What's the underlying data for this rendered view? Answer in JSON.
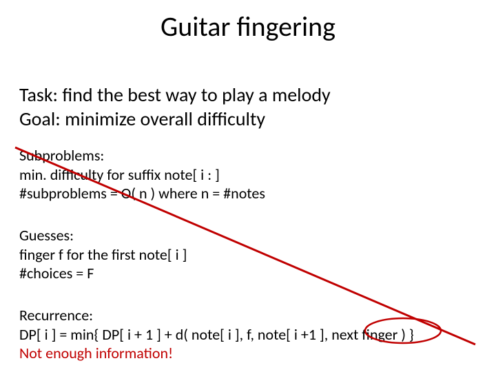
{
  "title": "Guitar fingering",
  "intro": {
    "task": "Task: find the best way to play a melody",
    "goal": "Goal: minimize overall difficulty"
  },
  "subproblems": {
    "h": "Subproblems:",
    "l1": "min. difficulty for suffix note[ i : ]",
    "l2": "#subproblems = O( n ) where n = #notes"
  },
  "guesses": {
    "h": "Guesses:",
    "l1": "finger f for the first note[ i ]",
    "l2": "#choices = F"
  },
  "recurrence": {
    "h": "Recurrence:",
    "l1": "DP[ i ] = min{  DP[ i + 1 ] + d( note[ i ], f, note[ i +1 ],  next finger   )  }",
    "err": "Not enough information!"
  },
  "annotations": {
    "strike": "red-strike-line",
    "circle": "red-circle-next-finger"
  }
}
